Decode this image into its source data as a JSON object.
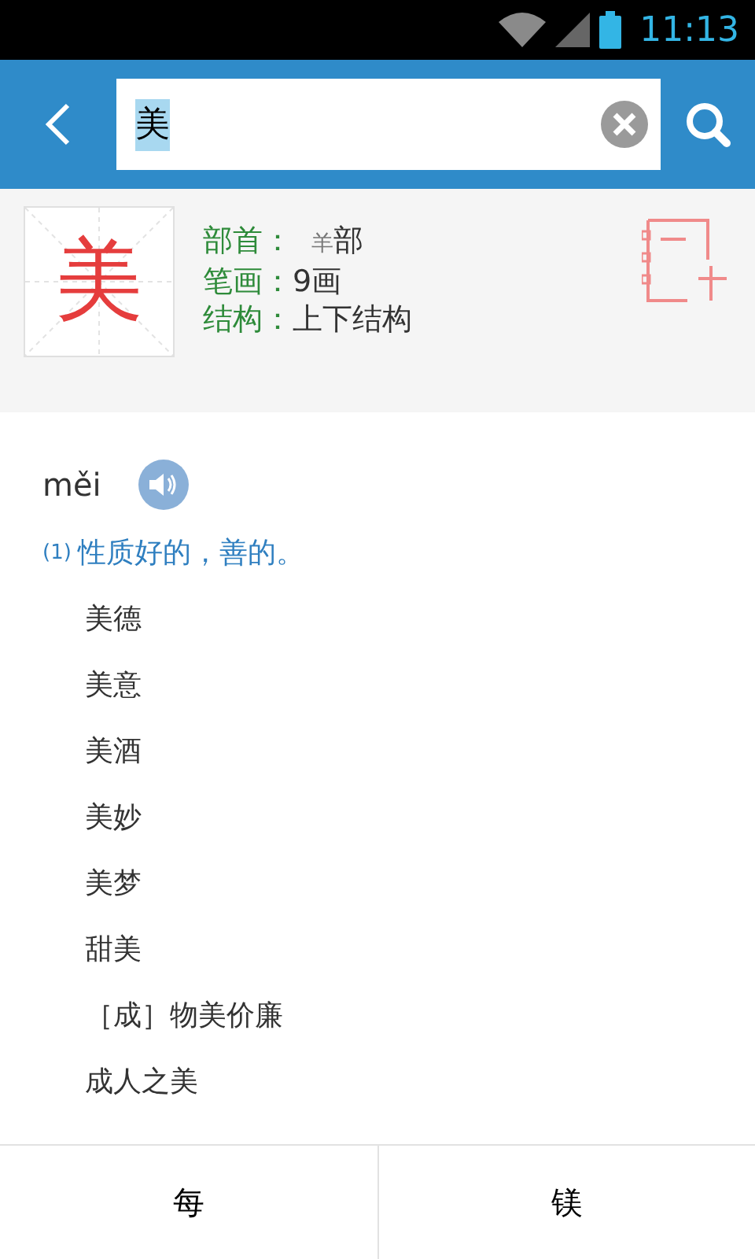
{
  "status_bar": {
    "time": "11:13"
  },
  "search": {
    "value": "美",
    "selected": true
  },
  "character": {
    "glyph": "美",
    "fields": [
      {
        "label": "部首：",
        "value": "羊",
        "suffix": "部"
      },
      {
        "label": "笔画：",
        "value": "9画"
      },
      {
        "label": "结构：",
        "value": "上下结构"
      }
    ]
  },
  "pinyin": "měi",
  "definitions": [
    {
      "number": "(1)",
      "text": "性质好的，善的。",
      "examples": [
        "美德",
        "美意",
        "美酒",
        "美妙",
        "美梦",
        "甜美",
        "［成］物美价廉",
        "成人之美"
      ]
    }
  ],
  "bottom_nav": [
    "每",
    "镁"
  ]
}
